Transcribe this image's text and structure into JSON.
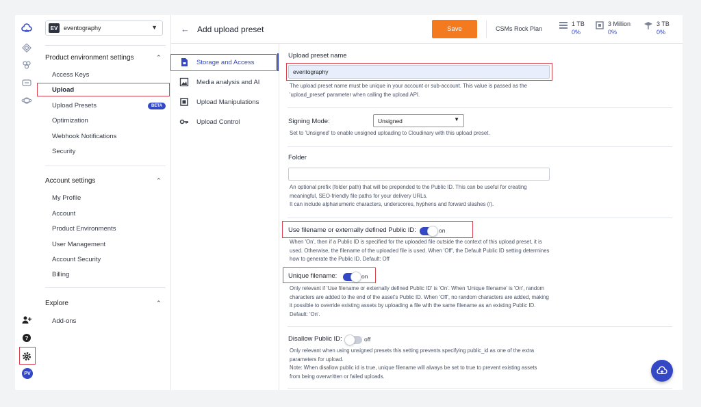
{
  "environment": {
    "badge": "EV",
    "name": "eventography"
  },
  "sidebar": {
    "product_section": "Product environment settings",
    "product_items": [
      "Access Keys",
      "Upload",
      "Upload Presets",
      "Optimization",
      "Webhook Notifications",
      "Security"
    ],
    "beta_label": "BETA",
    "account_section": "Account settings",
    "account_items": [
      "My Profile",
      "Account",
      "Product Environments",
      "User Management",
      "Account Security",
      "Billing"
    ],
    "explore_section": "Explore",
    "explore_items": [
      "Add-ons"
    ]
  },
  "header": {
    "title": "Add upload preset",
    "save_label": "Save",
    "plan": "CSMs Rock Plan",
    "quotas": [
      {
        "value": "1 TB",
        "percent": "0%"
      },
      {
        "value": "3 Million",
        "percent": "0%"
      },
      {
        "value": "3 TB",
        "percent": "0%"
      }
    ]
  },
  "tabs": [
    "Storage and Access",
    "Media analysis and AI",
    "Upload Manipulations",
    "Upload Control"
  ],
  "form": {
    "preset_name_label": "Upload preset name",
    "preset_name_value": "eventography",
    "preset_name_help_1": "The upload preset name must be unique in your account or sub-account. This value is passed as the",
    "preset_name_help_2": "'upload_preset' parameter when calling the upload API.",
    "signing_label": "Signing Mode:",
    "signing_value": "Unsigned",
    "signing_help": "Set to 'Unsigned' to enable unsigned uploading to Cloudinary with this upload preset.",
    "folder_label": "Folder",
    "folder_value": "",
    "folder_help_1": "An optional prefix (folder path) that will be prepended to the Public ID. This can be useful for creating",
    "folder_help_2": "meaningful, SEO-friendly file paths for your delivery URLs.",
    "folder_help_3": "It can include alphanumeric characters, underscores, hyphens and forward slashes (/).",
    "use_filename_label": "Use filename or externally defined Public ID:",
    "use_filename_state": "on",
    "use_filename_help_1": "When 'On', then if a Public ID is specified for the uploaded file outside the context of this upload preset, it is",
    "use_filename_help_2": "used. Otherwise, the filename of the uploaded file is used. When 'Off', the Default Public ID setting determines",
    "use_filename_help_3": "how to generate the Public ID. Default: Off",
    "unique_label": "Unique filename:",
    "unique_state": "on",
    "unique_help_1": "Only relevant if 'Use filename or externally defined Public ID' is 'On'. When 'Unique filename' is 'On', random",
    "unique_help_2": "characters are added to the end of the asset's Public ID. When 'Off', no random characters are added, making",
    "unique_help_3": "it possible to override existing assets by uploading a file with the same filename as an existing Public ID.",
    "unique_help_4": "Default: 'On'.",
    "disallow_label": "Disallow Public ID:",
    "disallow_state": "off",
    "disallow_help_1": "Only relevant when using unsigned presets this setting prevents specifying public_id as one of the extra",
    "disallow_help_2": "parameters for upload.",
    "disallow_help_3": "Note: When disallow public id is true, unique filename will always be set to true to prevent existing assets",
    "disallow_help_4": "from being overwritten or failed uploads."
  },
  "user": {
    "initials": "PV"
  },
  "colors": {
    "accent": "#3448c5",
    "save": "#f47a20",
    "highlight": "#d9434f"
  }
}
